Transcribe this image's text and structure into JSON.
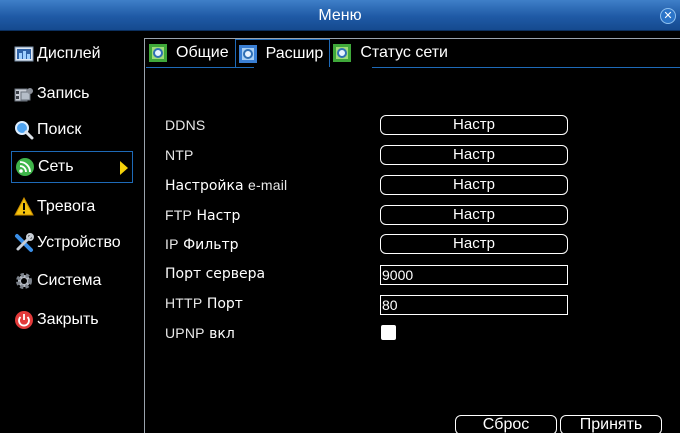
{
  "window": {
    "title": "Меню",
    "close_symbol": "✕"
  },
  "sidebar": {
    "items": [
      {
        "label": "Дисплей",
        "icon": "display-icon"
      },
      {
        "label": "Запись",
        "icon": "record-icon"
      },
      {
        "label": "Поиск",
        "icon": "search-icon"
      },
      {
        "label": "Сеть",
        "icon": "network-icon",
        "active": true
      },
      {
        "label": "Тревога",
        "icon": "alarm-icon"
      },
      {
        "label": "Устройство",
        "icon": "device-icon"
      },
      {
        "label": "Система",
        "icon": "system-icon"
      },
      {
        "label": "Закрыть",
        "icon": "power-icon"
      }
    ]
  },
  "tabs": [
    {
      "label": "Общие",
      "icon": "tab-general-icon"
    },
    {
      "label": "Расшир",
      "icon": "tab-advanced-icon",
      "active": true
    },
    {
      "label": "Статус сети",
      "icon": "tab-status-icon"
    }
  ],
  "settings": {
    "ddns": {
      "label": "DDNS",
      "button": "Настр"
    },
    "ntp": {
      "label": "NTP",
      "button": "Настр"
    },
    "email": {
      "label_a": "Настройка",
      "label_b": "e-mail",
      "button": "Настр"
    },
    "ftp": {
      "label_a": "FTP",
      "label_b": "Настр",
      "button": "Настр"
    },
    "ip": {
      "label_a": "IP",
      "label_b": "Фильтр",
      "button": "Настр"
    },
    "server_port": {
      "label": "Порт сервера",
      "value": "9000"
    },
    "http_port": {
      "label_a": "HTTP",
      "label_b": "Порт",
      "value": "80"
    },
    "upnp": {
      "label_a": "UPNP",
      "label_b": "вкл",
      "checked": false
    }
  },
  "footer": {
    "reset": "Сброс",
    "apply": "Принять"
  },
  "colors": {
    "titlebar": "#1f5aa6",
    "accent_border": "#1e6ab8",
    "arrow": "#f5d20a"
  }
}
